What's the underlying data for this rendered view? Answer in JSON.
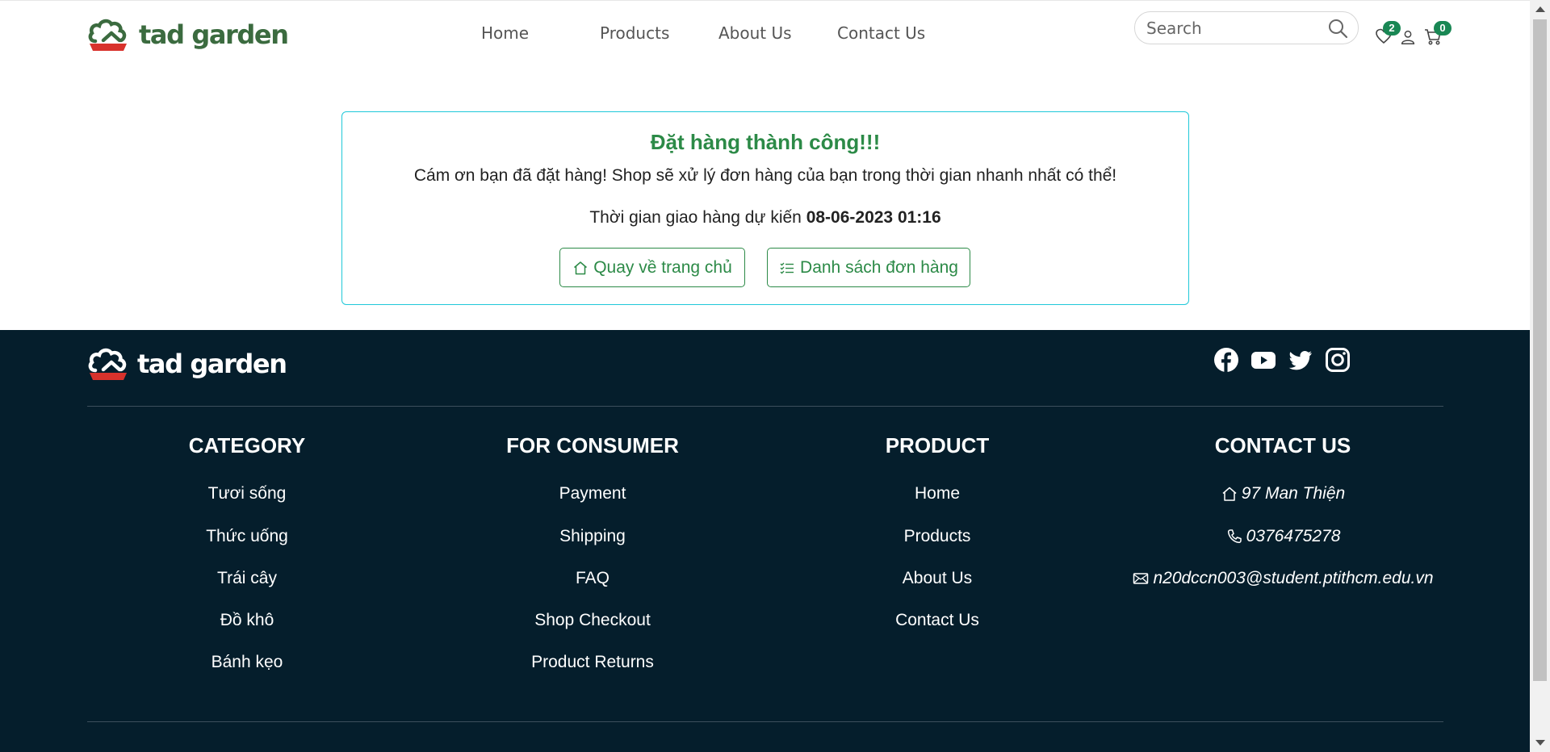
{
  "header": {
    "logo_text": "tad garden",
    "nav": [
      "Home",
      "Products",
      "About Us",
      "Contact Us"
    ],
    "search_placeholder": "Search",
    "wishlist_count": "2",
    "cart_count": "0"
  },
  "order": {
    "title": "Đặt hàng thành công!!!",
    "message": "Cám ơn bạn đã đặt hàng! Shop sẽ xử lý đơn hàng của bạn trong thời gian nhanh nhất có thể!",
    "eta_label": "Thời gian giao hàng dự kiến",
    "eta_value": "08-06-2023 01:16",
    "home_button": "Quay về trang chủ",
    "orders_button": "Danh sách đơn hàng"
  },
  "footer": {
    "logo_text": "tad garden",
    "columns": [
      {
        "title": "CATEGORY",
        "items": [
          "Tươi sống",
          "Thức uống",
          "Trái cây",
          "Đồ khô",
          "Bánh kẹo"
        ]
      },
      {
        "title": "FOR CONSUMER",
        "items": [
          "Payment",
          "Shipping",
          "FAQ",
          "Shop Checkout",
          "Product Returns"
        ]
      },
      {
        "title": "PRODUCT",
        "items": [
          "Home",
          "Products",
          "About Us",
          "Contact Us"
        ]
      },
      {
        "title": "CONTACT US",
        "items": [
          "97 Man Thiện",
          "0376475278",
          "n20dccn003@student.ptithcm.edu.vn"
        ]
      }
    ]
  },
  "colors": {
    "brand_green": "#2c8a47",
    "logo_green": "#3b6b3f",
    "badge_green": "#198754",
    "card_border": "#1fc8d9",
    "footer_bg": "#051e2c",
    "logo_red": "#d8322c"
  },
  "icons": [
    "search-icon",
    "heart-icon",
    "user-icon",
    "cart-icon",
    "home-icon",
    "list-icon",
    "facebook-icon",
    "youtube-icon",
    "twitter-icon",
    "instagram-icon",
    "phone-icon",
    "mail-icon"
  ]
}
